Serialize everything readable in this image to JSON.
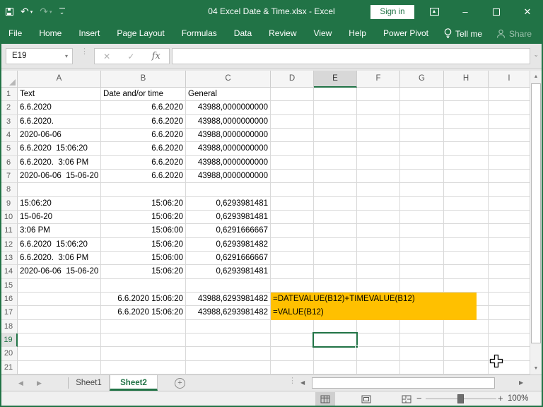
{
  "window": {
    "title": "04 Excel Date & Time.xlsx  -  Excel",
    "sign_in_label": "Sign in"
  },
  "ribbon": {
    "tabs": [
      "File",
      "Home",
      "Insert",
      "Page Layout",
      "Formulas",
      "Data",
      "Review",
      "View",
      "Help",
      "Power Pivot"
    ],
    "tell_me_label": "Tell me",
    "share_label": "Share"
  },
  "formula_bar": {
    "cell_reference": "E19",
    "formula_content": ""
  },
  "grid": {
    "columns": [
      "A",
      "B",
      "C",
      "D",
      "E",
      "F",
      "G",
      "H",
      "I"
    ],
    "selection": {
      "column": "E",
      "row": 19
    },
    "highlight": {
      "row_start": 16,
      "row_end": 17,
      "start_column": "D",
      "color": "#ffc000"
    },
    "rows": [
      {
        "n": 1,
        "cells": {
          "A": "Text",
          "B": "Date and/or time",
          "C": "General"
        }
      },
      {
        "n": 2,
        "cells": {
          "A": "6.6.2020",
          "B": "6.6.2020",
          "C": "43988,0000000000"
        }
      },
      {
        "n": 3,
        "cells": {
          "A": "6.6.2020.",
          "B": "6.6.2020",
          "C": "43988,0000000000"
        }
      },
      {
        "n": 4,
        "cells": {
          "A": "2020-06-06",
          "B": "6.6.2020",
          "C": "43988,0000000000"
        }
      },
      {
        "n": 5,
        "cells": {
          "A": "6.6.2020  15:06:20",
          "B": "6.6.2020",
          "C": "43988,0000000000"
        }
      },
      {
        "n": 6,
        "cells": {
          "A": "6.6.2020.  3:06 PM",
          "B": "6.6.2020",
          "C": "43988,0000000000"
        }
      },
      {
        "n": 7,
        "cells": {
          "A": "2020-06-06  15-06-20",
          "B": "6.6.2020",
          "C": "43988,0000000000"
        }
      },
      {
        "n": 8,
        "cells": {}
      },
      {
        "n": 9,
        "cells": {
          "A": "15:06:20",
          "B": "15:06:20",
          "C": "0,6293981481"
        }
      },
      {
        "n": 10,
        "cells": {
          "A": "15-06-20",
          "B": "15:06:20",
          "C": "0,6293981481"
        }
      },
      {
        "n": 11,
        "cells": {
          "A": "3:06 PM",
          "B": "15:06:00",
          "C": "0,6291666667"
        }
      },
      {
        "n": 12,
        "cells": {
          "A": "6.6.2020  15:06:20",
          "B": "15:06:20",
          "C": "0,6293981482"
        }
      },
      {
        "n": 13,
        "cells": {
          "A": "6.6.2020.  3:06 PM",
          "B": "15:06:00",
          "C": "0,6291666667"
        }
      },
      {
        "n": 14,
        "cells": {
          "A": "2020-06-06  15-06-20",
          "B": "15:06:20",
          "C": "0,6293981481"
        }
      },
      {
        "n": 15,
        "cells": {}
      },
      {
        "n": 16,
        "cells": {
          "B": "6.6.2020 15:06:20",
          "C": "43988,6293981482",
          "D": "=DATEVALUE(B12)+TIMEVALUE(B12)"
        }
      },
      {
        "n": 17,
        "cells": {
          "B": "6.6.2020 15:06:20",
          "C": "43988,6293981482",
          "D": "=VALUE(B12)"
        }
      },
      {
        "n": 18,
        "cells": {}
      },
      {
        "n": 19,
        "cells": {}
      },
      {
        "n": 20,
        "cells": {}
      },
      {
        "n": 21,
        "cells": {}
      }
    ]
  },
  "sheet_bar": {
    "tabs": [
      "Sheet1",
      "Sheet2"
    ],
    "active_tab": "Sheet2",
    "new_sheet_label": "+"
  },
  "status_bar": {
    "zoom_level": "100%",
    "zoom_minus": "−",
    "zoom_plus": "+"
  },
  "icons": {
    "undo": "↶",
    "redo": "↷",
    "caret_down": "▾",
    "chevron_down": "⌄",
    "ribbon_options_arrow": "▲",
    "minimize": "–",
    "close": "✕",
    "cancel": "✕",
    "enter": "✓",
    "insert_function": "fx",
    "vdots": "⋮",
    "nav_left": "◀",
    "nav_right": "▶",
    "scroll_up": "▲",
    "scroll_down": "▼"
  },
  "colors": {
    "accent_green": "#217346",
    "highlight_yellow": "#ffc000",
    "gridline": "#d9d9d9"
  }
}
